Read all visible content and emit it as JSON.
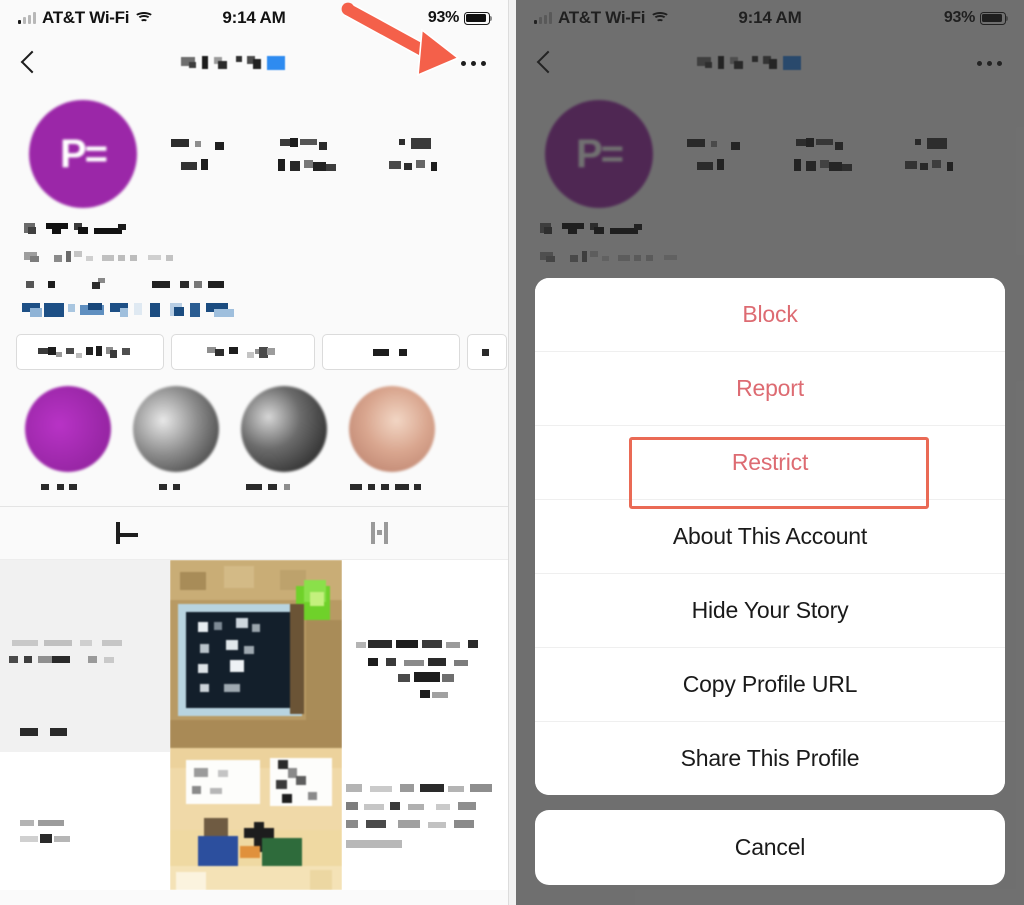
{
  "status_bar": {
    "carrier": "AT&T Wi-Fi",
    "time": "9:14 AM",
    "battery_percent": "93%",
    "wifi_icon": "wifi-icon",
    "signal_icon": "cellular-bars-icon",
    "battery_icon": "battery-icon"
  },
  "nav_bar": {
    "back_icon": "chevron-left-icon",
    "title": "",
    "more_icon": "ellipsis-icon"
  },
  "profile": {
    "avatar_label": "P=",
    "avatar_color": "#9b27a8",
    "stats": [
      {
        "value": "",
        "label": ""
      },
      {
        "value": "",
        "label": ""
      },
      {
        "value": "",
        "label": ""
      }
    ],
    "bio_lines": [
      "",
      "",
      ""
    ],
    "bio_link": "",
    "action_buttons": [
      {
        "label": ""
      },
      {
        "label": ""
      },
      {
        "label": ""
      },
      {
        "label": ""
      }
    ],
    "highlights": [
      {
        "label": "",
        "color": "#9b27a8"
      },
      {
        "label": "",
        "color": "#6d6d6d"
      },
      {
        "label": "",
        "color": "#3a3a3a"
      },
      {
        "label": "",
        "color": "#d9a68f"
      }
    ],
    "tabs": [
      {
        "icon": "grid-icon",
        "selected": true
      },
      {
        "icon": "tagged-icon",
        "selected": false
      }
    ]
  },
  "action_sheet": {
    "items": [
      {
        "label": "Block",
        "style": "danger"
      },
      {
        "label": "Report",
        "style": "danger"
      },
      {
        "label": "Restrict",
        "style": "danger",
        "highlighted": true
      },
      {
        "label": "About This Account",
        "style": "default"
      },
      {
        "label": "Hide Your Story",
        "style": "default"
      },
      {
        "label": "Copy Profile URL",
        "style": "default"
      },
      {
        "label": "Share This Profile",
        "style": "default"
      }
    ],
    "cancel_label": "Cancel"
  },
  "annotations": {
    "arrow_color": "#f4604a",
    "arrow_target": "ellipsis-icon",
    "highlight_box_color": "#ea6a55",
    "highlight_box_target": "Restrict"
  }
}
